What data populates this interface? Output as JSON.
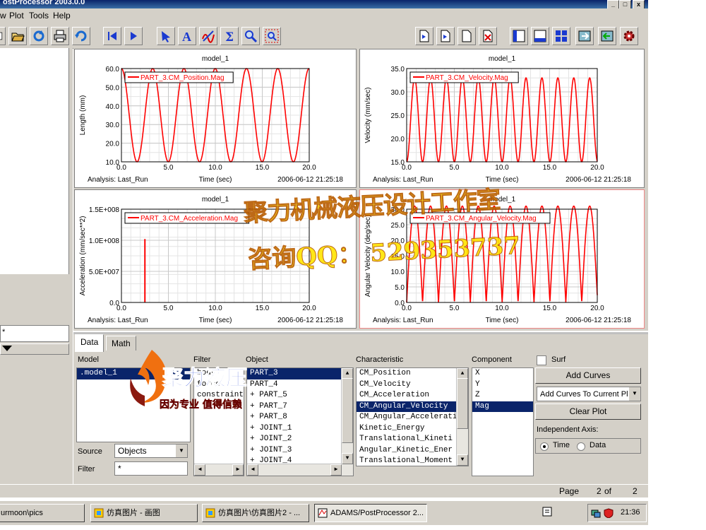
{
  "window": {
    "title": "ostProcessor 2003.0.0",
    "buttons": [
      "_",
      "□",
      "x"
    ]
  },
  "menu": {
    "items": [
      "w",
      "Plot",
      "Tools",
      "Help"
    ]
  },
  "toolbar": {
    "icons": [
      "page-icon",
      "open-folder-icon",
      "reload-icon",
      "print-icon",
      "undo-icon",
      "first-page-icon",
      "next-page-icon",
      "pointer-icon",
      "text-annotate-icon",
      "curve-edit-icon",
      "sigma-stats-icon",
      "zoom-icon",
      "zoom-fit-icon",
      "new-page-icon",
      "copy-page-icon",
      "blank-page-icon",
      "delete-page-icon",
      "layout-one-icon",
      "layout-two-icon",
      "layout-four-icon",
      "import-icon",
      "export-icon",
      "settings-gear-icon"
    ]
  },
  "left": {
    "filter_value": "*"
  },
  "plots": [
    {
      "title": "model_1",
      "legend": "PART_3.CM_Position.Mag",
      "ylabel": "Length (mm)",
      "xlabel": "Time (sec)",
      "analysis": "Analysis:  Last_Run",
      "timestamp": "2006-06-12 21:25:18",
      "yticks": [
        "10.0",
        "20.0",
        "30.0",
        "40.0",
        "50.0",
        "60.0"
      ],
      "xticks": [
        "0.0",
        "5.0",
        "10.0",
        "15.0",
        "20.0"
      ],
      "color": "#ff0000"
    },
    {
      "title": "model_1",
      "legend": "PART_3.CM_Velocity.Mag",
      "ylabel": "Velocity (mm/sec)",
      "xlabel": "Time (sec)",
      "analysis": "Analysis:  Last_Run",
      "timestamp": "2006-06-12 21:25:18",
      "yticks": [
        "15.0",
        "20.0",
        "25.0",
        "30.0",
        "35.0"
      ],
      "xticks": [
        "0.0",
        "5.0",
        "10.0",
        "15.0",
        "20.0"
      ],
      "color": "#ff0000"
    },
    {
      "title": "model_1",
      "legend": "PART_3.CM_Acceleration.Mag",
      "ylabel": "Acceleration (mm/sec**2)",
      "xlabel": "Time (sec)",
      "analysis": "Analysis:  Last_Run",
      "timestamp": "2006-06-12 21:25:18",
      "yticks": [
        "0.0",
        "5.0E+007",
        "1.0E+008",
        "1.5E+008"
      ],
      "xticks": [
        "0.0",
        "5.0",
        "10.0",
        "15.0",
        "20.0"
      ],
      "color": "#ff0000"
    },
    {
      "title": "model_1",
      "legend": "PART_3.CM_Angular_Velocity.Mag",
      "ylabel": "Angular Velocity (deg/sec)",
      "xlabel": "Time (sec)",
      "analysis": "Analysis:  Last_Run",
      "timestamp": "2006-06-12 21:25:18",
      "yticks": [
        "0.0",
        "5.0",
        "10.0",
        "15.0",
        "20.0",
        "25.0",
        "30.0"
      ],
      "xticks": [
        "0.0",
        "5.0",
        "10.0",
        "15.0",
        "20.0"
      ],
      "color": "#ff0000"
    }
  ],
  "chart_data": [
    {
      "type": "line",
      "title": "model_1",
      "xlabel": "Time (sec)",
      "ylabel": "Length (mm)",
      "xlim": [
        0,
        20
      ],
      "ylim": [
        10,
        60
      ],
      "grid": true,
      "legend": "top-left",
      "series": [
        {
          "name": "PART_3.CM_Position.Mag",
          "shape": "sinusoid",
          "min": 10,
          "max": 60,
          "period": 3.33,
          "start": 60
        }
      ]
    },
    {
      "type": "line",
      "title": "model_1",
      "xlabel": "Time (sec)",
      "ylabel": "Velocity (mm/sec)",
      "xlim": [
        0,
        20
      ],
      "ylim": [
        15,
        35
      ],
      "grid": true,
      "legend": "top-left",
      "series": [
        {
          "name": "PART_3.CM_Velocity.Mag",
          "shape": "sinusoid",
          "min": 15,
          "max": 33,
          "period": 1.67,
          "start": 17
        }
      ]
    },
    {
      "type": "line",
      "title": "model_1",
      "xlabel": "Time (sec)",
      "ylabel": "Acceleration (mm/sec**2)",
      "xlim": [
        0,
        20
      ],
      "ylim": [
        0,
        150000000
      ],
      "grid": true,
      "legend": "top-left",
      "series": [
        {
          "name": "PART_3.CM_Acceleration.Mag",
          "spikes": [
            {
              "x": 2.5,
              "y": 102000000
            }
          ]
        }
      ]
    },
    {
      "type": "line",
      "title": "model_1",
      "xlabel": "Time (sec)",
      "ylabel": "Angular Velocity (deg/sec)",
      "xlim": [
        0,
        20
      ],
      "ylim": [
        0,
        30
      ],
      "grid": true,
      "legend": "top-left",
      "series": [
        {
          "name": "PART_3.CM_Angular_Velocity.Mag",
          "shape": "abs-sinusoid",
          "min": 0,
          "max": 31,
          "period": 1.67,
          "start": 0
        }
      ]
    }
  ],
  "bottom": {
    "tabs": [
      "Data",
      "Math"
    ],
    "labels": {
      "model": "Model",
      "filter": "Filter",
      "object": "Object",
      "characteristic": "Characteristic",
      "component": "Component",
      "surf": "Surf",
      "source": "Source",
      "filter2": "Filter",
      "indep": "Independent Axis:",
      "time": "Time",
      "data": "Data"
    },
    "model_items": [
      ".model_1"
    ],
    "filter_items": [
      "body",
      "force",
      "constraint"
    ],
    "object_items": [
      "PART_3",
      "PART_4",
      "+ PART_5",
      "+ PART_7",
      "+ PART_8",
      "+ JOINT_1",
      "+ JOINT_2",
      "+ JOINT_3",
      "+ JOINT_4"
    ],
    "characteristic_items": [
      "CM_Position",
      "CM_Velocity",
      "CM_Acceleration",
      "CM_Angular_Velocity",
      "CM_Angular_Accelerati",
      "Kinetic_Energy",
      "Translational_Kineti",
      "Angular_Kinetic_Ener",
      "Translational_Moment"
    ],
    "component_items": [
      "X",
      "Y",
      "Z",
      "Mag"
    ],
    "source_value": "Objects",
    "filter_value": "*",
    "add_curves": "Add Curves",
    "add_mode": "Add Curves To Current Plo",
    "clear_plot": "Clear Plot"
  },
  "status": {
    "page_label": "Page",
    "page_num": "2",
    "of": "of",
    "total": "2"
  },
  "taskbar": {
    "items": [
      "urmoon\\pics",
      "仿真图片 - 画图",
      "仿真图片\\仿真图片2 - ...",
      "ADAMS/PostProcessor 2..."
    ],
    "clock": "21:36"
  },
  "watermark": {
    "line1": "聚力机械液压设计工作室",
    "line2": "咨询QQ：  529353737",
    "logo_main": "聚力液压",
    "logo_sub": "因为专业 值得信赖"
  }
}
